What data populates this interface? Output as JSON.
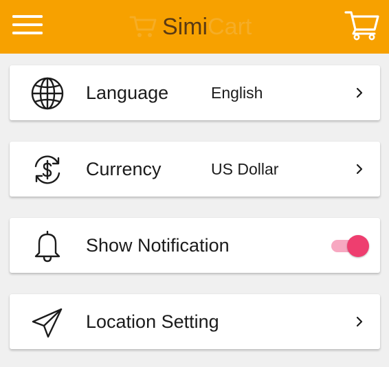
{
  "header": {
    "logo": {
      "simi": "Simi",
      "cart": "Cart"
    },
    "menu_icon": "hamburger-icon",
    "cart_icon": "cart-icon",
    "background_color": "#f7a100"
  },
  "settings": [
    {
      "label": "Language",
      "value": "English",
      "icon": "globe-icon",
      "control": "chevron"
    },
    {
      "label": "Currency",
      "value": "US Dollar",
      "icon": "currency-exchange-icon",
      "control": "chevron"
    },
    {
      "label": "Show Notification",
      "icon": "bell-icon",
      "control": "toggle",
      "enabled": true
    },
    {
      "label": "Location Setting",
      "icon": "paper-plane-icon",
      "control": "chevron"
    }
  ],
  "colors": {
    "toggle_thumb": "#ee3e6f",
    "toggle_track": "#f7a8c1",
    "card_background": "#ffffff",
    "page_background": "#f0f0f0"
  }
}
